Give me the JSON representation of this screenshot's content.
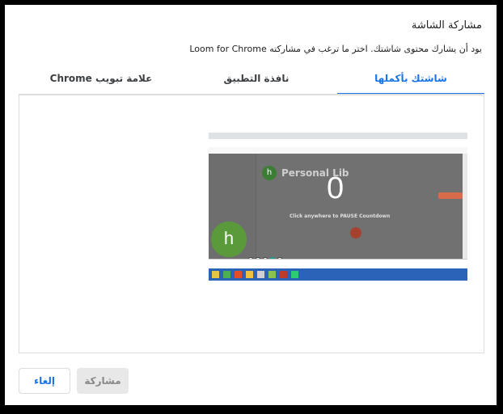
{
  "dialog": {
    "title": "مشاركة الشاشة",
    "subtitle": "يود أن يشارك محتوى شاشتك. اختر ما ترغب في مشاركته Loom for Chrome"
  },
  "tabs": [
    {
      "label": "شاشتك بأكملها",
      "active": true
    },
    {
      "label": "نافذة التطبيق",
      "active": false
    },
    {
      "label": "علامة تبويب Chrome",
      "active": false
    }
  ],
  "preview": {
    "avatar_letter": "h",
    "library_title": "Personal Lib",
    "countdown": "0",
    "overlay_text": "Click anywhere to PAUSE Countdown"
  },
  "buttons": {
    "cancel": "إلغاء",
    "share": "مشاركة"
  },
  "colors": {
    "accent": "#1a73e8",
    "avatar_green": "#5a9a3a"
  }
}
